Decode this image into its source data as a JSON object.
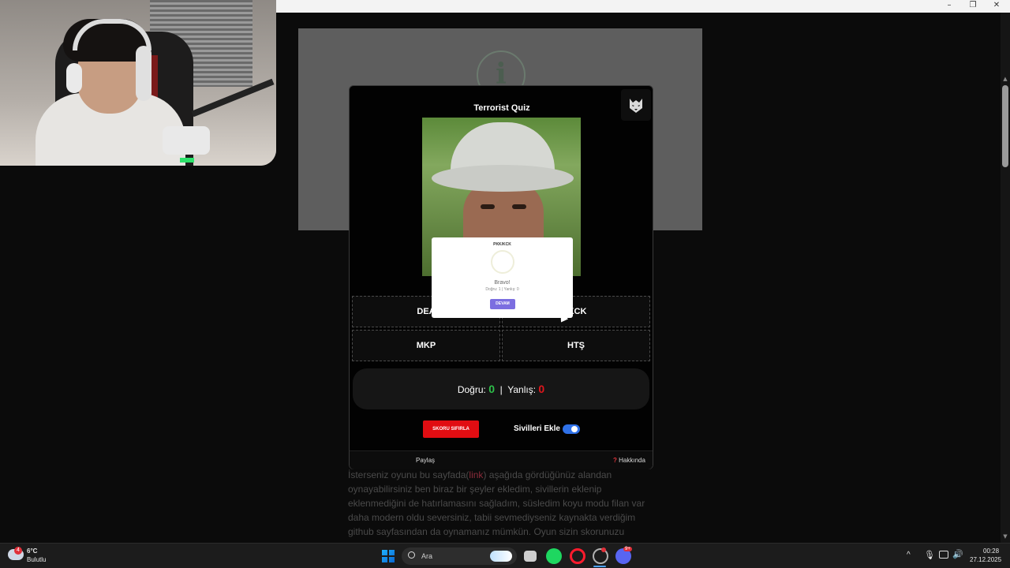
{
  "window": {
    "minimize": "–",
    "restore": "❐",
    "close": "✕"
  },
  "background_page": {
    "info_icon": "i",
    "article_prefix": "İsterseniz oyunu bu sayfada(",
    "article_link": "link",
    "article_lines": [
      ") aşağıda gördüğünüz alandan",
      "oynayabilirsiniz ben biraz bir şeyler ekledim, sivillerin eklenip",
      "eklenmediğini de hatırlamasını sağladım, süsledim koyu modu filan var",
      "daha modern oldu seversiniz, tabii sevmediyseniz kaynakta verdiğim",
      "github sayfasından da oynamanız mümkün. Oyun sizin skorunuzu"
    ]
  },
  "quiz": {
    "title": "Terrorist Quiz",
    "wolf_icon": "wolf-icon",
    "popup": {
      "title": "PKK/KCK",
      "message": "Bravo!",
      "score_line": "Doğru: 1 | Yanlış: 0",
      "button": "DEVAM"
    },
    "answers": [
      "DEA",
      "/KCK",
      "MKP",
      "HTŞ"
    ],
    "score": {
      "correct_label": "Doğru:",
      "correct": "0",
      "separator": "|",
      "wrong_label": "Yanlış:",
      "wrong": "0"
    },
    "reset_button": "SKORU SIFIRLA",
    "civilians_label": "Sivilleri Ekle",
    "civilians_enabled": true,
    "share": "Paylaş",
    "about_icon": "?",
    "about": "Hakkında"
  },
  "taskbar": {
    "weather_temp": "6°C",
    "weather_desc": "Bulutlu",
    "weather_badge": "4",
    "search_placeholder": "Ara",
    "discord_badge": "9+",
    "time": "00:28",
    "date": "27.12.2025",
    "tray_chevron": "^"
  },
  "colors": {
    "correct": "#2ec04a",
    "wrong": "#e0161c",
    "reset": "#e10d12",
    "toggle": "#2f71e8",
    "popup_button": "#7c6ee0"
  }
}
